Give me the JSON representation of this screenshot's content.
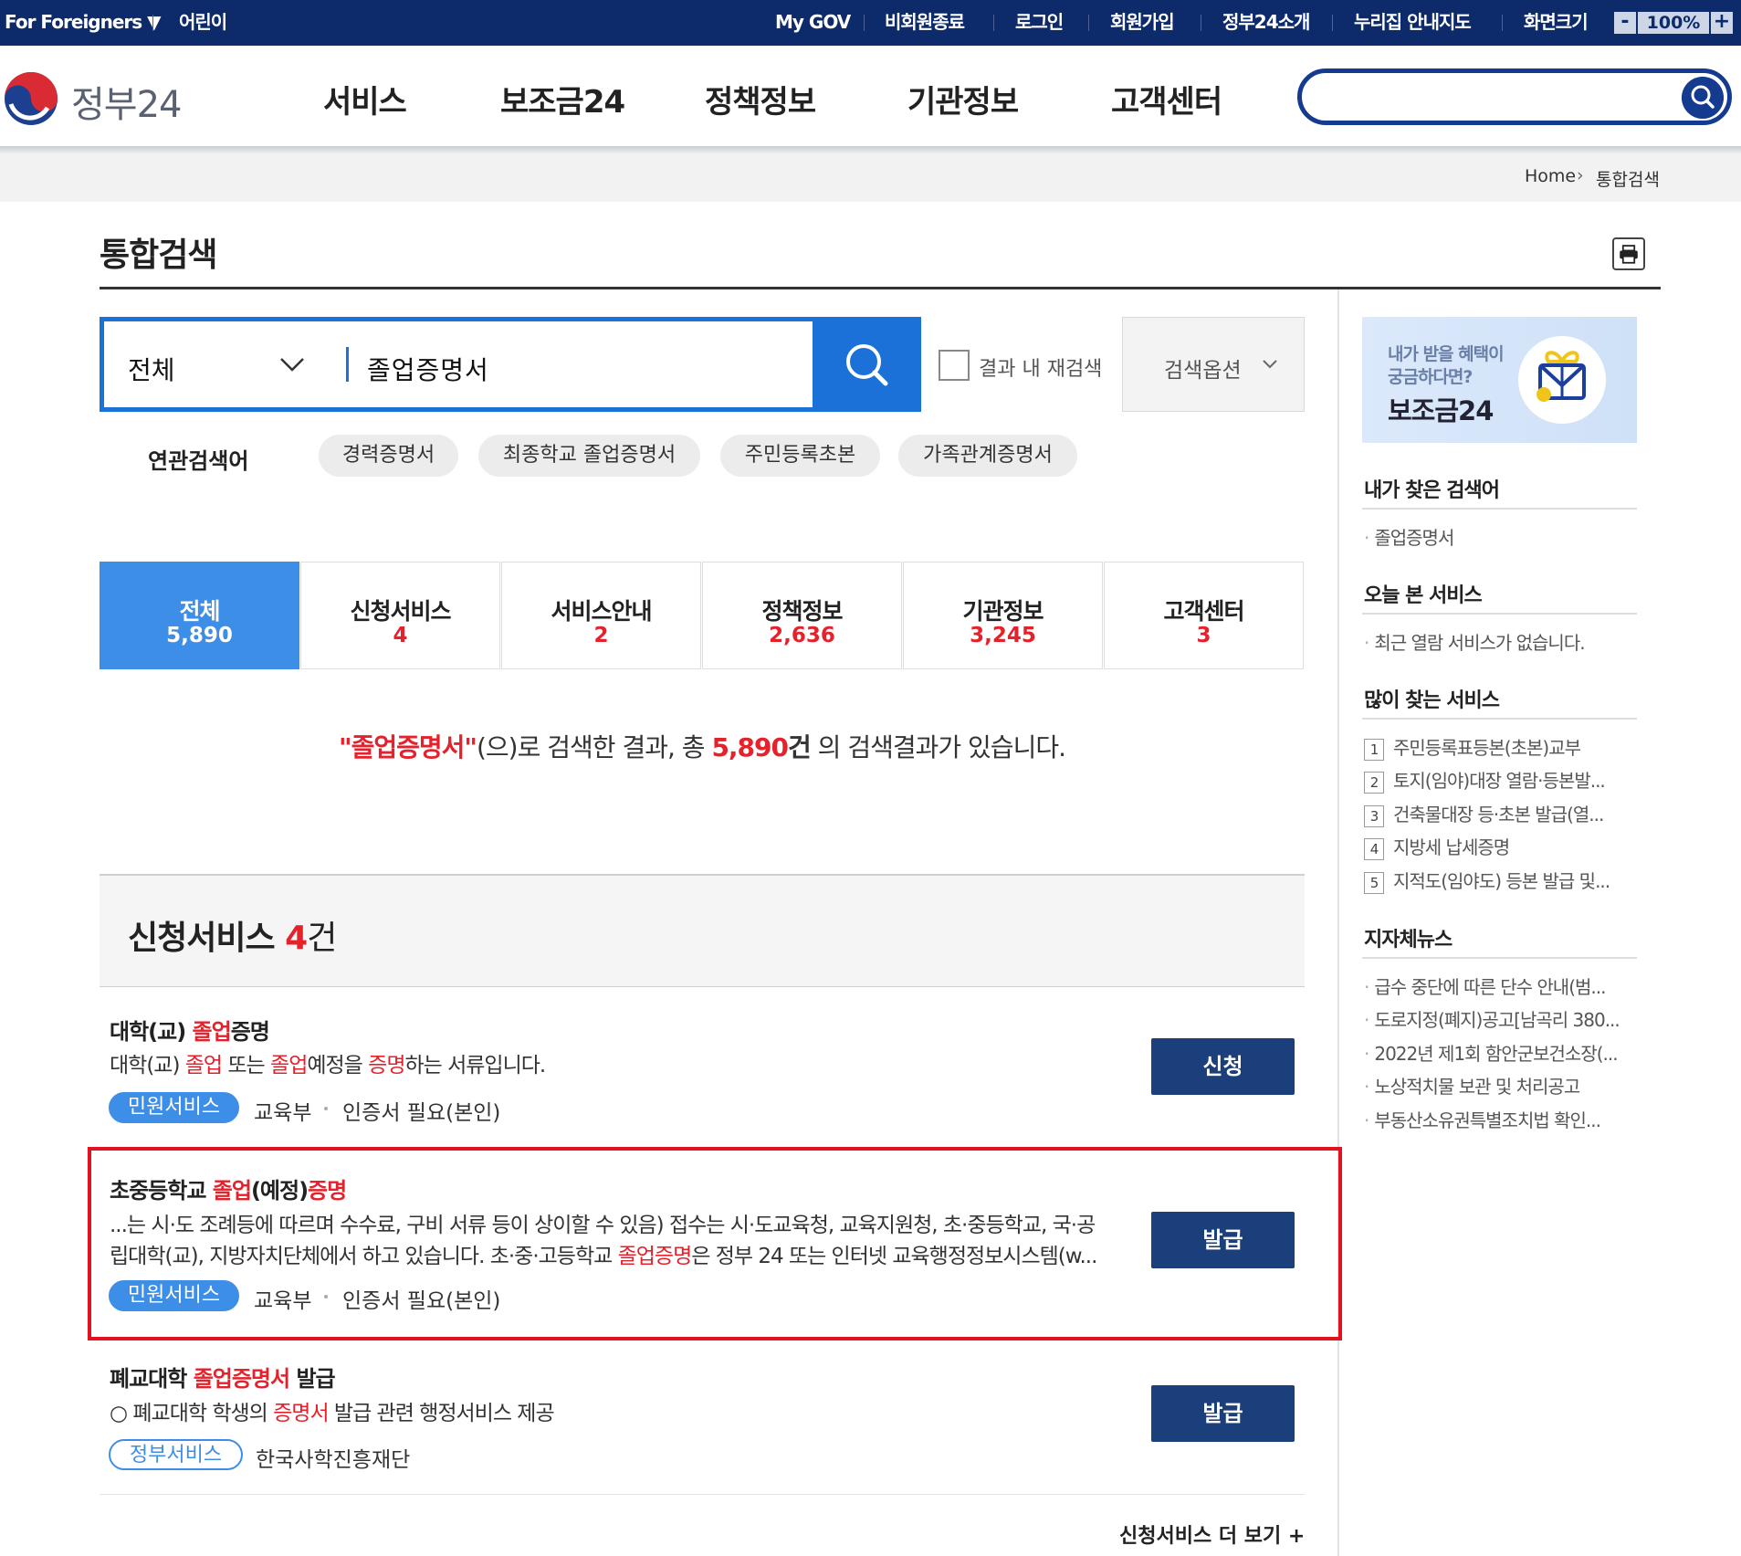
{
  "topbar": {
    "foreigners": "For Foreigners ▼",
    "kids": "어린이",
    "mygov": "My GOV",
    "nonmember_end": "비회원종료",
    "login": "로그인",
    "signup": "회원가입",
    "about": "정부24소개",
    "site_guide": "누리집 안내지도",
    "screen_size": "화면크기",
    "zoom_minus": "-",
    "zoom_value": "100%",
    "zoom_plus": "+"
  },
  "header": {
    "logo_text": "정부24",
    "nav": [
      "서비스",
      "보조금24",
      "정책정보",
      "기관정보",
      "고객센터"
    ]
  },
  "breadcrumb": {
    "home": "Home",
    "arrow": "›",
    "current": "통합검색"
  },
  "page": {
    "title": "통합검색"
  },
  "search": {
    "scope": "전체",
    "query": "졸업증명서",
    "recheck_label": "결과 내 재검색",
    "options_label": "검색옵션"
  },
  "related": {
    "label": "연관검색어",
    "keywords": [
      "경력증명서",
      "최종학교 졸업증명서",
      "주민등록초본",
      "가족관계증명서"
    ]
  },
  "tabs": [
    {
      "label": "전체",
      "count": "5,890"
    },
    {
      "label": "신청서비스",
      "count": "4"
    },
    {
      "label": "서비스안내",
      "count": "2"
    },
    {
      "label": "정책정보",
      "count": "2,636"
    },
    {
      "label": "기관정보",
      "count": "3,245"
    },
    {
      "label": "고객센터",
      "count": "3"
    }
  ],
  "summary": {
    "query_quoted": "\"졸업증명서\"",
    "mid": "(으)로 검색한 결과, 총 ",
    "count": "5,890",
    "unit": "건",
    "tail": " 의 검색결과가 있습니다."
  },
  "section": {
    "title": "신청서비스",
    "count": "4",
    "unit": "건",
    "more": "신청서비스 더 보기 +"
  },
  "results": [
    {
      "title": {
        "p1": "대학(교) ",
        "h1": "졸업",
        "p2": "증명"
      },
      "desc": {
        "p1": "대학(교) ",
        "h1": "졸업",
        "p2": " 또는 ",
        "h2": "졸업",
        "p3": "예정을 ",
        "h3": "증명",
        "p4": "하는 서류입니다."
      },
      "tag": "민원서비스",
      "agency": "교육부",
      "cert": "인증서 필요(본인)",
      "button": "신청"
    },
    {
      "title": {
        "p1": "초중등학교 ",
        "h1": "졸업",
        "p2": "(예정)",
        "h2": "증명"
      },
      "desc_line1": "...는 시·도 조례등에 따르며 수수료, 구비 서류 등이 상이할 수 있음) 접수는 시·도교육청, 교육지원청, 초·중등학교, 국·공",
      "desc_line2": {
        "p1": "립대학(교), 지방자치단체에서 하고 있습니다. 초·중·고등학교 ",
        "h1": "졸업증명",
        "p2": "은 정부 24 또는 인터넷 교육행정정보시스템(w..."
      },
      "tag": "민원서비스",
      "agency": "교육부",
      "cert": "인증서 필요(본인)",
      "button": "발급"
    },
    {
      "title": {
        "p1": "폐교대학 ",
        "h1": "졸업증명서",
        "p2": " 발급"
      },
      "desc": {
        "p1": "○ 폐교대학 학생의 ",
        "h1": "증명서",
        "p2": " 발급 관련 행정서비스 제공"
      },
      "tag": "정부서비스",
      "agency": "한국사학진흥재단",
      "button": "발급"
    }
  ],
  "sidebar": {
    "banner": {
      "line1": "내가 받을 혜택이",
      "line2": "궁금하다면?",
      "title": "보조금24"
    },
    "my_searches": {
      "heading": "내가 찾은 검색어",
      "items": [
        "졸업증명서"
      ]
    },
    "today_viewed": {
      "heading": "오늘 본 서비스",
      "empty": "최근 열람 서비스가 없습니다."
    },
    "popular": {
      "heading": "많이 찾는 서비스",
      "items": [
        {
          "rank": "1",
          "label": "주민등록표등본(초본)교부"
        },
        {
          "rank": "2",
          "label": "토지(임야)대장 열람·등본발..."
        },
        {
          "rank": "3",
          "label": "건축물대장 등·초본 발급(열..."
        },
        {
          "rank": "4",
          "label": "지방세 납세증명"
        },
        {
          "rank": "5",
          "label": "지적도(임야도) 등본 발급 및..."
        }
      ]
    },
    "local_news": {
      "heading": "지자체뉴스",
      "items": [
        "급수 중단에 따른 단수 안내(범...",
        "도로지정(폐지)공고[남곡리 380...",
        "2022년 제1회 함안군보건소장(...",
        "노상적치물 보관 및 처리공고",
        "부동산소유권특별조치법 확인..."
      ]
    }
  },
  "colors": {
    "navy": "#0d2a6b",
    "blue": "#1c71d8",
    "tab_active": "#3d8ee6",
    "highlight": "#e5212b",
    "button": "#1b3f7a"
  }
}
